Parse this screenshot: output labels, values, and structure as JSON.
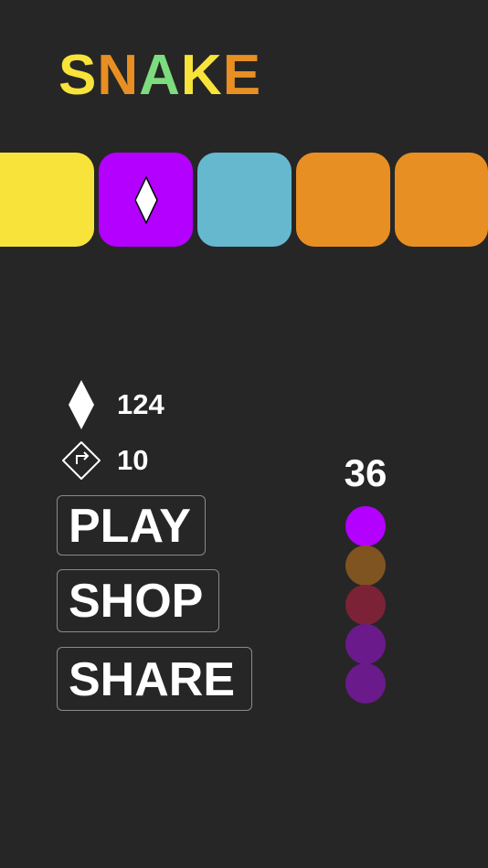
{
  "title": {
    "letters": [
      {
        "char": "S",
        "color": "#f8e33a"
      },
      {
        "char": "N",
        "color": "#e88f23"
      },
      {
        "char": "A",
        "color": "#7ddc7d"
      },
      {
        "char": "K",
        "color": "#f8e33a"
      },
      {
        "char": "E",
        "color": "#e88f23"
      }
    ]
  },
  "tiles": [
    {
      "color": "#f8e33a",
      "icon": ""
    },
    {
      "color": "#b300ff",
      "icon": "diamond-icon"
    },
    {
      "color": "#66b8cf",
      "icon": ""
    },
    {
      "color": "#e88f23",
      "icon": ""
    },
    {
      "color": "#e88f23",
      "icon": ""
    }
  ],
  "stats": {
    "gems": {
      "value": "124",
      "icon": "diamond-icon"
    },
    "moves": {
      "value": "10",
      "icon": "turn-arrow-icon"
    }
  },
  "buttons": {
    "play": "PLAY",
    "shop": "SHOP",
    "share": "SHARE"
  },
  "score": "36",
  "snake_colors": [
    "#b300ff",
    "#805420",
    "#7c2236",
    "#6a1a8a",
    "#6a1a8a"
  ]
}
